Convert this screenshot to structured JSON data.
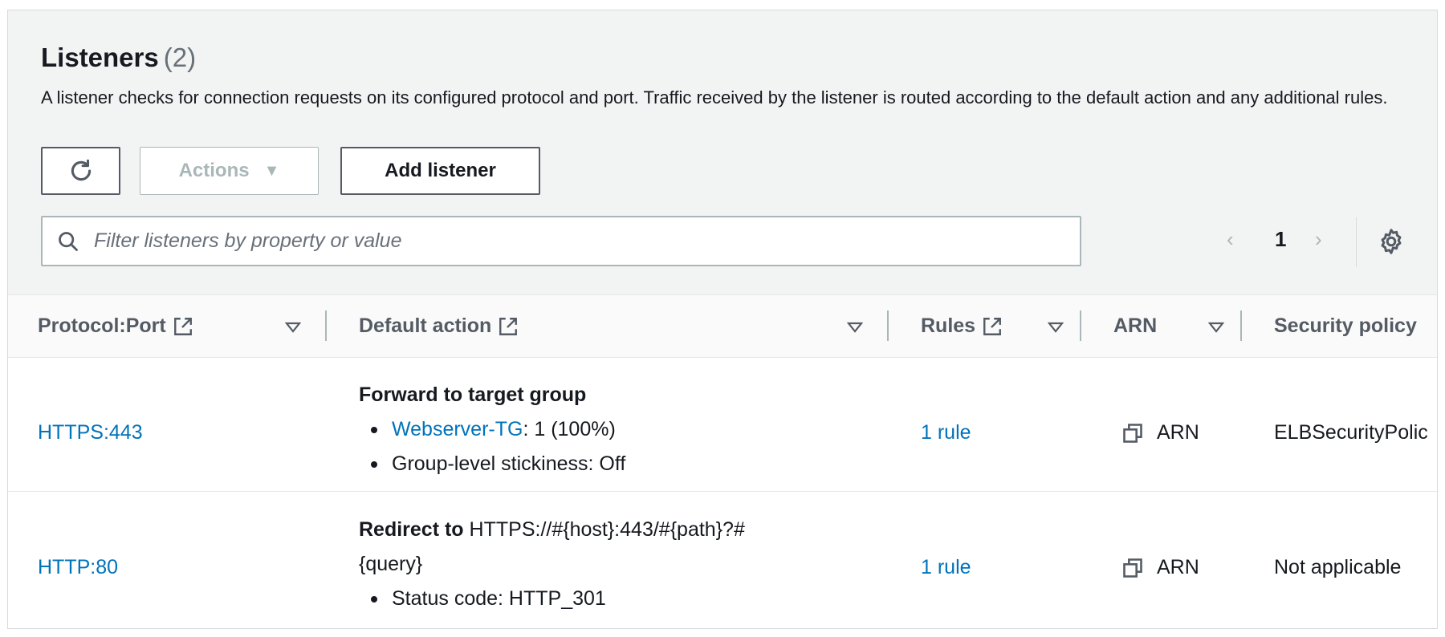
{
  "panel": {
    "title": "Listeners",
    "count": "(2)",
    "description": "A listener checks for connection requests on its configured protocol and port. Traffic received by the listener is routed according to the default action and any additional rules."
  },
  "toolbar": {
    "refresh_icon": "refresh-icon",
    "actions_label": "Actions",
    "add_label": "Add listener"
  },
  "search": {
    "placeholder": "Filter listeners by property or value",
    "value": ""
  },
  "pagination": {
    "prev": "‹",
    "page": "1",
    "next": "›",
    "settings_icon": "gear-icon"
  },
  "columns": {
    "protocol_port": "Protocol:Port",
    "default_action": "Default action",
    "rules": "Rules",
    "arn": "ARN",
    "security_policy": "Security policy"
  },
  "rows": [
    {
      "protocol_port": "HTTPS:443",
      "action_title": "Forward to target group",
      "target_group": "Webserver-TG",
      "target_weight": ": 1 (100%)",
      "stickiness": "Group-level stickiness: Off",
      "rules": "1 rule",
      "arn": "ARN",
      "security_policy": "ELBSecurityPolic"
    },
    {
      "protocol_port": "HTTP:80",
      "action_title": "Redirect to",
      "redirect_url_line1": "HTTPS://#{host}:443/#{path}?#",
      "redirect_url_line2": "{query}",
      "status_code": "Status code: HTTP_301",
      "rules": "1 rule",
      "arn": "ARN",
      "security_policy": "Not applicable"
    }
  ],
  "colors": {
    "link": "#0073bb",
    "header_bg": "#f2f3f3",
    "text": "#16191f",
    "muted": "#545b64",
    "disabled": "#aab7b8"
  }
}
